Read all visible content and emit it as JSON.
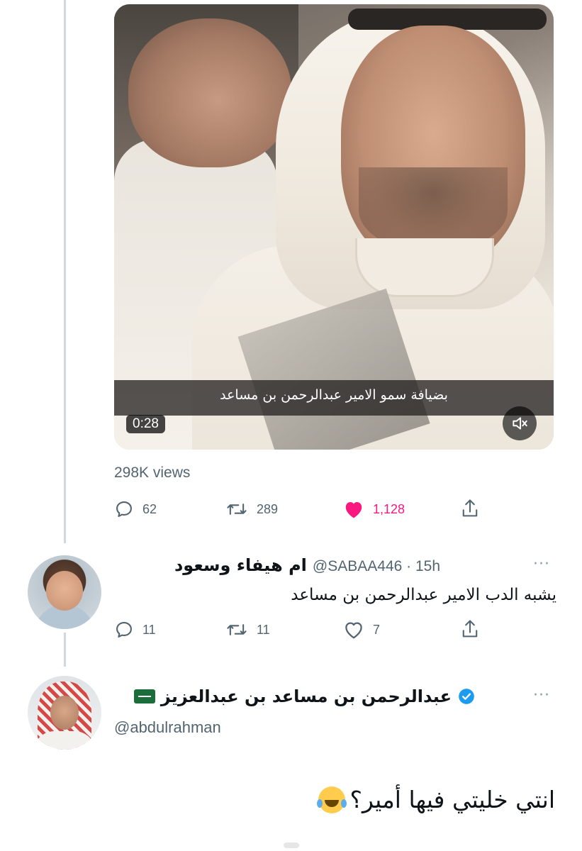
{
  "tweet": {
    "video": {
      "caption": "بضيافة سمو الامير عبدالرحمن بن مساعد",
      "duration": "0:28",
      "mute_icon": "speaker-muted-icon"
    },
    "views": "298K views",
    "actions": {
      "replies": "62",
      "retweets": "289",
      "likes": "1,128",
      "like_color": "#f91880"
    }
  },
  "reply1": {
    "name": "ام هيفاء وسعود",
    "handle_time": "@SABAA446 · 15h",
    "text": "يشبه الدب الامير عبدالرحمن بن مساعد",
    "actions": {
      "replies": "11",
      "retweets": "11",
      "likes": "7"
    }
  },
  "reply2": {
    "name": "عبدالرحمن بن مساعد بن عبدالعزيز",
    "verified_color": "#1d9bf0",
    "handle": "@abdulrahman",
    "text": "انتي خليتي فيها أمير؟"
  },
  "colors": {
    "muted": "#536471",
    "thread_line": "#cfd9de"
  }
}
